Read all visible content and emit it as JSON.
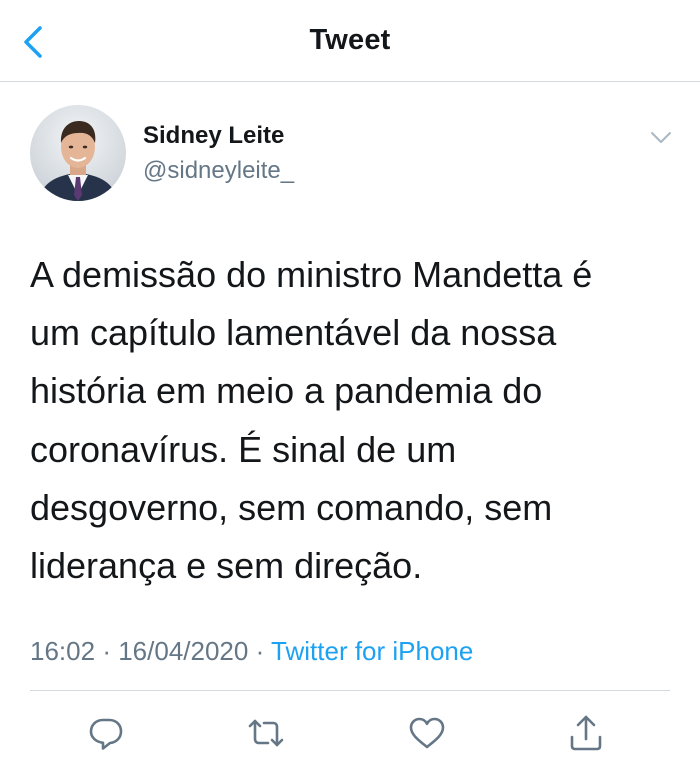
{
  "nav": {
    "title": "Tweet"
  },
  "tweet": {
    "author_name": "Sidney Leite",
    "author_handle": "@sidneyleite_",
    "text": "A demissão do ministro Mandetta é\num capítulo lamentável da nossa\nhistória em meio a pandemia do\ncoronavírus. É sinal de um\ndesgoverno, sem comando, sem\nliderança e sem direção.",
    "time": "16:02",
    "separator": "·",
    "date": "16/04/2020",
    "source": "Twitter for iPhone"
  },
  "icons": {
    "back": "chevron-left-icon",
    "caret": "chevron-down-icon",
    "reply": "reply-icon",
    "retweet": "retweet-icon",
    "like": "heart-icon",
    "share": "share-icon"
  },
  "colors": {
    "accent": "#1da1f2",
    "text": "#14171a",
    "secondary": "#657786",
    "border": "#d3dbe1"
  }
}
